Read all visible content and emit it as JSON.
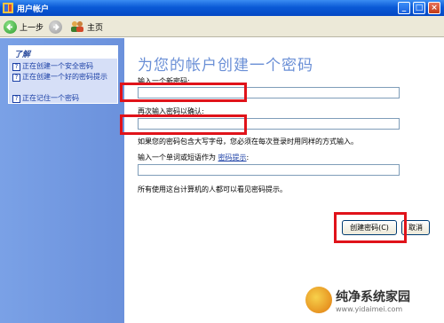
{
  "window": {
    "title": "用户帐户",
    "controls": [
      "minimize",
      "maximize",
      "close"
    ]
  },
  "toolbar": {
    "back_label": "上一步",
    "home_label": "主页"
  },
  "sidebar": {
    "header": "了解",
    "items": [
      {
        "label": "正在创建一个安全密码"
      },
      {
        "label": "正在创建一个好的密码提示"
      },
      {
        "label": "正在记住一个密码"
      }
    ]
  },
  "main": {
    "heading": "为您的帐户创建一个密码",
    "new_password_label": "输入一个新密码:",
    "new_password_value": "",
    "confirm_label": "再次输入密码以确认:",
    "confirm_value": "",
    "case_note": "如果您的密码包含大写字母，您必须在每次登录时用同样的方式输入。",
    "hint_label_prefix": "输入一个单词或短语作为",
    "hint_link": "密码提示",
    "hint_colon": ":",
    "hint_value": "",
    "hint_note": "所有使用这台计算机的人都可以看见密码提示。",
    "create_button": "创建密码(C)",
    "cancel_button": "取消"
  },
  "watermark": {
    "main": "纯净系统家园",
    "url": "www.yidaimei.com"
  },
  "colors": {
    "title_bar": "#0a5ad6",
    "sidebar": "#7aa1e6",
    "heading": "#6a8fd6",
    "highlight": "#e0131a"
  }
}
